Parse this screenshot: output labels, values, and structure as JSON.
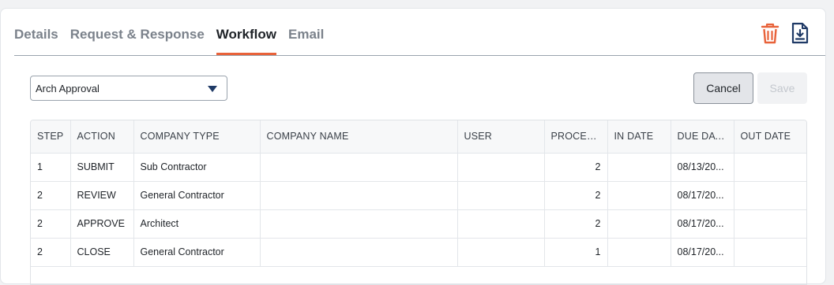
{
  "tabs": [
    {
      "label": "Details"
    },
    {
      "label": "Request & Response"
    },
    {
      "label": "Workflow"
    },
    {
      "label": "Email"
    }
  ],
  "active_tab": "Workflow",
  "accent_color": "#e8623a",
  "icons": {
    "delete": "trash-icon",
    "export": "download-file-icon"
  },
  "workflow_select": {
    "value": "Arch Approval"
  },
  "buttons": {
    "cancel": "Cancel",
    "save": "Save"
  },
  "table": {
    "columns": [
      "STEP",
      "ACTION",
      "COMPANY TYPE",
      "COMPANY NAME",
      "USER",
      "PROCES...",
      "IN DATE",
      "DUE DATE",
      "OUT DATE"
    ],
    "rows": [
      [
        "1",
        "SUBMIT",
        "Sub Contractor",
        "",
        "",
        "2",
        "",
        "08/13/20...",
        ""
      ],
      [
        "2",
        "REVIEW",
        "General Contractor",
        "",
        "",
        "2",
        "",
        "08/17/20...",
        ""
      ],
      [
        "2",
        "APPROVE",
        "Architect",
        "",
        "",
        "2",
        "",
        "08/17/20...",
        ""
      ],
      [
        "2",
        "CLOSE",
        "General Contractor",
        "",
        "",
        "1",
        "",
        "08/17/20...",
        ""
      ]
    ]
  }
}
